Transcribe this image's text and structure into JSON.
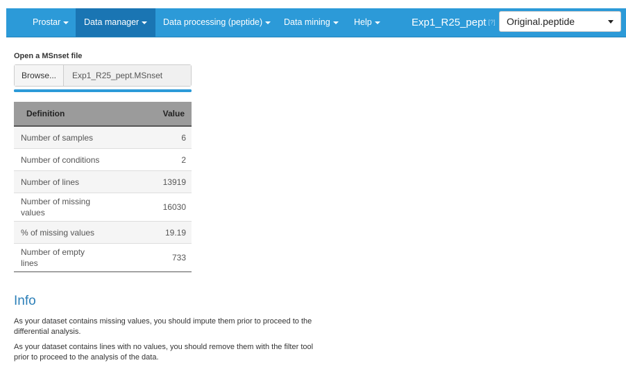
{
  "navbar": {
    "items": [
      {
        "label": "Prostar",
        "dropdown": true
      },
      {
        "label": "Data manager",
        "dropdown": true,
        "active": true
      },
      {
        "label": "Data processing (peptide)",
        "dropdown": true
      },
      {
        "label": "Data mining",
        "dropdown": true
      },
      {
        "label": "Help",
        "dropdown": true
      }
    ],
    "dataset_name": "Exp1_R25_pept",
    "help_mark": "[?]",
    "dataset_select": {
      "selected": "Original.peptide"
    }
  },
  "file_input": {
    "label": "Open a MSnset file",
    "browse_label": "Browse...",
    "file_name": "Exp1_R25_pept.MSnset",
    "upload_progress": 1.0
  },
  "summary_table": {
    "headers": {
      "definition": "Definition",
      "value": "Value"
    },
    "rows": [
      {
        "definition": "Number of samples",
        "value": "6"
      },
      {
        "definition": "Number of conditions",
        "value": "2"
      },
      {
        "definition": "Number of lines",
        "value": "13919"
      },
      {
        "definition": "Number of missing values",
        "value": "16030"
      },
      {
        "definition": "% of missing values",
        "value": "19.19"
      },
      {
        "definition": "Number of empty lines",
        "value": "733"
      }
    ]
  },
  "info": {
    "title": "Info",
    "paragraphs": [
      "As your dataset contains missing values, you should impute them prior to proceed to the differential analysis.",
      "As your dataset contains lines with no values, you should remove them with the filter tool prior to proceed to the analysis of the data."
    ]
  },
  "colors": {
    "navbar_bg": "#2c9ad8",
    "navbar_active": "#1a75b3",
    "table_header_bg": "#9b9b9b",
    "info_title": "#2c7fb8"
  }
}
